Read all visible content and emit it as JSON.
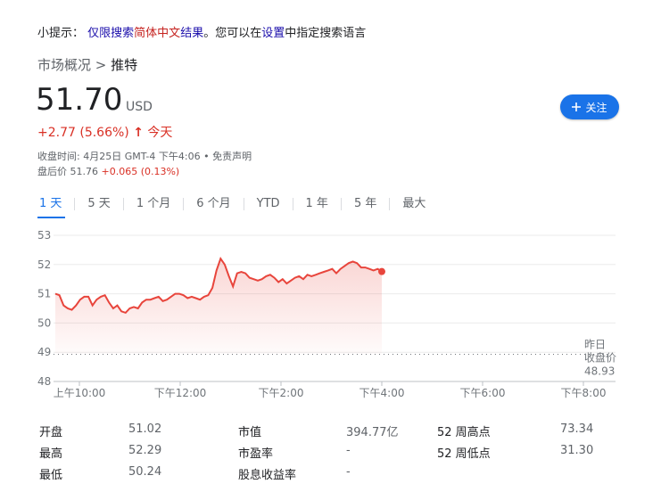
{
  "hint": {
    "prefix": "小提示：",
    "link1": "仅限搜索",
    "red": "简体中文",
    "link2": "结果",
    "middle": "。您可以在",
    "link3": "设置",
    "suffix": "中指定搜索语言"
  },
  "breadcrumb": {
    "root": "市场概况",
    "sep": " > ",
    "current": "推特"
  },
  "quote": {
    "price": "51.70",
    "currency": "USD",
    "change": "+2.77 (5.66%)",
    "arrow": "↑",
    "period": "今天",
    "meta": "收盘时间: 4月25日 GMT-4 下午4:06 • 免责声明",
    "after_label": "盘后价 51.76 ",
    "after_change": "+0.065 (0.13%)"
  },
  "follow_button": {
    "icon": "plus-icon",
    "label": "关注"
  },
  "tabs": [
    "1 天",
    "5 天",
    "1 个月",
    "6 个月",
    "YTD",
    "1 年",
    "5 年",
    "最大"
  ],
  "colors": {
    "accent": "#1a73e8",
    "down_red": "#d93025",
    "line": "#e8453c"
  },
  "chart_data": {
    "type": "line",
    "yticks": [
      "53",
      "52",
      "51",
      "50",
      "49",
      "48"
    ],
    "xticks": [
      "上午10:00",
      "下午12:00",
      "下午2:00",
      "下午4:00",
      "下午6:00",
      "下午8:00"
    ],
    "ylim": [
      48,
      53
    ],
    "prev_close": 48.93,
    "prev_close_label": [
      "昨日",
      "收盘价",
      "48.93"
    ],
    "series": [
      {
        "values": [
          51.0,
          50.95,
          50.6,
          50.5,
          50.45,
          50.6,
          50.8,
          50.9,
          50.9,
          50.6,
          50.8,
          50.9,
          50.95,
          50.7,
          50.5,
          50.6,
          50.4,
          50.35,
          50.5,
          50.55,
          50.5,
          50.7,
          50.8,
          50.8,
          50.85,
          50.9,
          50.75,
          50.8,
          50.9,
          51.0,
          51.0,
          50.95,
          50.85,
          50.9,
          50.85,
          50.8,
          50.9,
          50.95,
          51.2,
          51.8,
          52.2,
          52.0,
          51.6,
          51.25,
          51.7,
          51.75,
          51.7,
          51.55,
          51.5,
          51.45,
          51.5,
          51.6,
          51.65,
          51.55,
          51.4,
          51.5,
          51.35,
          51.45,
          51.55,
          51.6,
          51.5,
          51.65,
          51.6,
          51.65,
          51.7,
          51.75,
          51.8,
          51.85,
          51.7,
          51.85,
          51.95,
          52.05,
          52.1,
          52.05,
          51.9,
          51.9,
          51.85,
          51.8,
          51.85,
          51.76
        ]
      }
    ]
  },
  "stats": [
    {
      "label": "开盘",
      "value": "51.02"
    },
    {
      "label": "最高",
      "value": "52.29"
    },
    {
      "label": "最低",
      "value": "50.24"
    },
    {
      "label": "市值",
      "value": "394.77亿"
    },
    {
      "label": "市盈率",
      "value": "-"
    },
    {
      "label": "股息收益率",
      "value": "-"
    },
    {
      "label": "52 周高点",
      "value": "73.34"
    },
    {
      "label": "52 周低点",
      "value": "31.30"
    }
  ]
}
